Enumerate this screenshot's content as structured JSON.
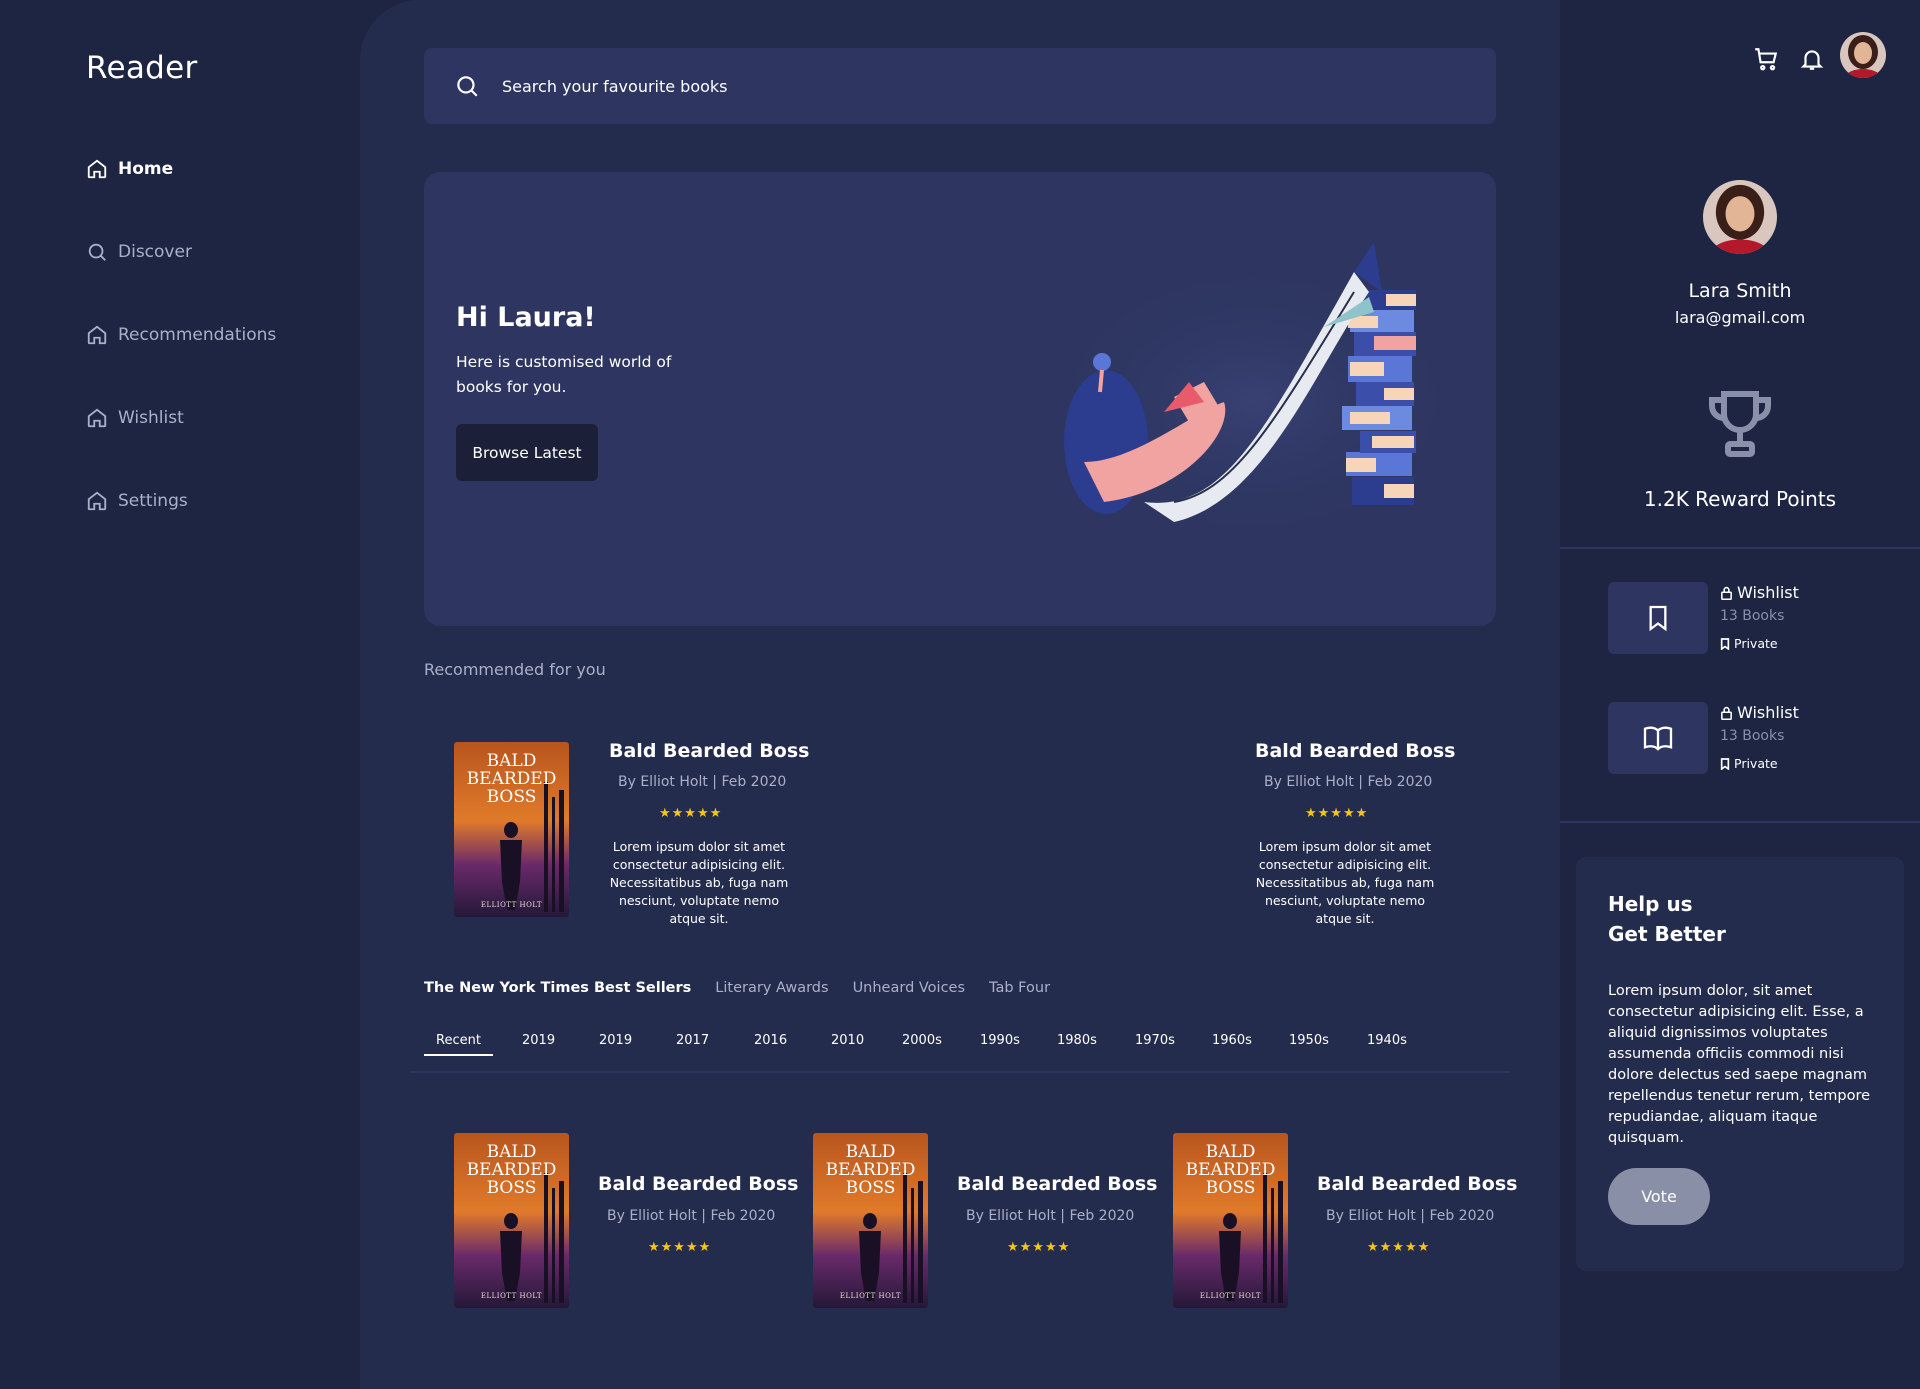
{
  "app": {
    "logo": "Reader"
  },
  "sidebar": {
    "items": [
      {
        "label": "Home",
        "icon": "home-icon",
        "active": true
      },
      {
        "label": "Discover",
        "icon": "search-icon"
      },
      {
        "label": "Recommendations",
        "icon": "home-icon"
      },
      {
        "label": "Wishlist",
        "icon": "home-icon"
      },
      {
        "label": "Settings",
        "icon": "home-icon"
      }
    ]
  },
  "search": {
    "placeholder": "Search your favourite books"
  },
  "hero": {
    "title": "Hi Laura!",
    "subtitle": "Here is customised world of books for you.",
    "button": "Browse Latest"
  },
  "recommended": {
    "title": "Recommended for you",
    "books": [
      {
        "cover_title": "BALD BEARDED BOSS",
        "cover_author": "ELLIOTT HOLT",
        "title": "Bald Bearded Boss",
        "meta": "By Elliot Holt | Feb 2020",
        "rating": "★★★★★",
        "description": "Lorem ipsum dolor sit amet consectetur adipisicing elit. Necessitatibus ab, fuga nam nesciunt, voluptate nemo atque sit."
      },
      {
        "title": "Bald Bearded Boss",
        "meta": "By Elliot Holt | Feb 2020",
        "rating": "★★★★★",
        "description": "Lorem ipsum dolor sit amet consectetur adipisicing elit. Necessitatibus ab, fuga nam nesciunt, voluptate nemo atque sit."
      }
    ]
  },
  "tabs": [
    "The New York Times Best Sellers",
    "Literary Awards",
    "Unheard Voices",
    "Tab Four"
  ],
  "years": [
    "Recent",
    "2019",
    "2019",
    "2017",
    "2016",
    "2010",
    "2000s",
    "1990s",
    "1980s",
    "1970s",
    "1960s",
    "1950s",
    "1940s"
  ],
  "bestsellers": [
    {
      "cover_title": "BALD BEARDED BOSS",
      "cover_author": "ELLIOTT HOLT",
      "title": "Bald Bearded Boss",
      "meta": "By Elliot Holt | Feb 2020",
      "rating": "★★★★★"
    },
    {
      "cover_title": "BALD BEARDED BOSS",
      "cover_author": "ELLIOTT HOLT",
      "title": "Bald Bearded Boss",
      "meta": "By Elliot Holt | Feb 2020",
      "rating": "★★★★★"
    },
    {
      "cover_title": "BALD BEARDED BOSS",
      "cover_author": "ELLIOTT HOLT",
      "title": "Bald Bearded Boss",
      "meta": "By Elliot Holt | Feb 2020",
      "rating": "★★★★★"
    }
  ],
  "profile": {
    "name": "Lara Smith",
    "email": "lara@gmail.com",
    "reward": "1.2K Reward Points"
  },
  "wishlists": [
    {
      "label": "Wishlist",
      "count": "13 Books",
      "privacy": "Private",
      "icon": "bookmark-icon"
    },
    {
      "label": "Wishlist",
      "count": "13 Books",
      "privacy": "Private",
      "icon": "open-book-icon"
    }
  ],
  "help": {
    "title_line1": "Help us",
    "title_line2": "Get Better",
    "body": "Lorem ipsum dolor, sit amet consectetur adipisicing elit. Esse, a aliquid dignissimos voluptates assumenda officiis commodi nisi dolore delectus sed saepe magnam repellendus tenetur rerum, tempore repudiandae, aliquam itaque quisquam.",
    "button": "Vote"
  },
  "colors": {
    "background": "#1e2542",
    "panel": "#242c4e",
    "card": "#2d3560",
    "star": "#f5c518"
  }
}
